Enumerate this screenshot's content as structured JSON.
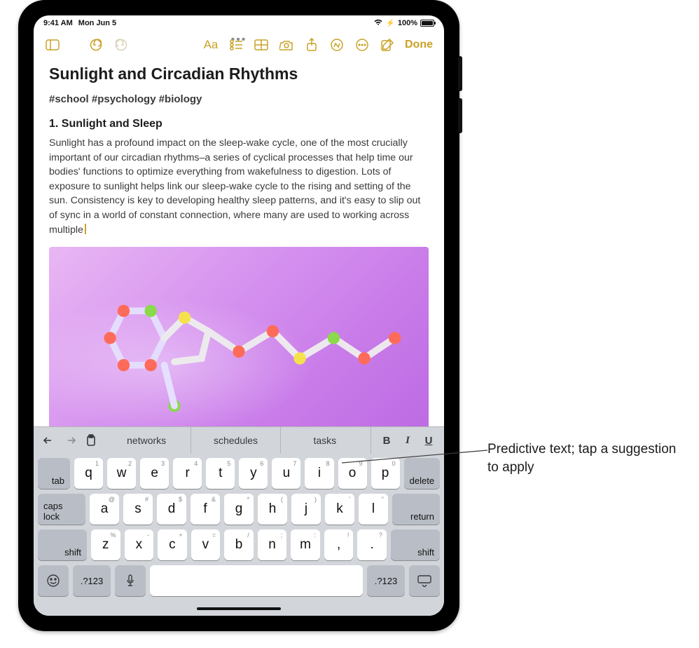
{
  "status": {
    "time": "9:41 AM",
    "date": "Mon Jun 5",
    "battery": "100%"
  },
  "toolbar": {
    "done": "Done",
    "icons": {
      "sidebar": "sidebar-icon",
      "undo": "undo-icon",
      "redo": "redo-icon",
      "format": "Aa",
      "checklist": "checklist-icon",
      "table": "table-icon",
      "camera": "camera-icon",
      "share": "share-icon",
      "markup": "markup-icon",
      "more": "more-icon",
      "compose": "compose-icon"
    }
  },
  "note": {
    "title": "Sunlight and Circadian Rhythms",
    "tags": "#school #psychology #biology",
    "heading": "1. Sunlight and Sleep",
    "body_before_cursor": "Sunlight has a profound impact on the sleep-wake cycle, one of the most crucially important of our circadian rhythms–a series of cyclical processes that help time our bodies' functions to optimize everything from wakefulness to digestion. Lots of exposure to sunlight helps link our sleep-wake cycle to the rising and setting of the sun. Consistency is key to developing healthy sleep patterns, and it's easy to slip out of sync in a world of constant connection, where many are used to working across multiple"
  },
  "keyboard": {
    "predictions": [
      "networks",
      "schedules",
      "tasks"
    ],
    "format": {
      "bold": "B",
      "italic": "I",
      "underline": "U"
    },
    "row1_alt": [
      "1",
      "2",
      "3",
      "4",
      "5",
      "6",
      "7",
      "8",
      "9",
      "0"
    ],
    "row1": [
      "q",
      "w",
      "e",
      "r",
      "t",
      "y",
      "u",
      "i",
      "o",
      "p"
    ],
    "row2_alt": [
      "@",
      "#",
      "$",
      "&",
      "*",
      "(",
      ")",
      "'",
      "\""
    ],
    "row2": [
      "a",
      "s",
      "d",
      "f",
      "g",
      "h",
      "j",
      "k",
      "l"
    ],
    "row3_alt": [
      "%",
      "-",
      "+",
      "=",
      "/",
      ";",
      ":",
      "!",
      "?"
    ],
    "row3": [
      "z",
      "x",
      "c",
      "v",
      "b",
      "n",
      "m",
      ",",
      "."
    ],
    "funcs": {
      "tab": "tab",
      "delete": "delete",
      "caps": "caps lock",
      "return": "return",
      "shift": "shift",
      "numsym": ".?123"
    }
  },
  "callout": {
    "text": "Predictive text; tap a suggestion to apply"
  }
}
